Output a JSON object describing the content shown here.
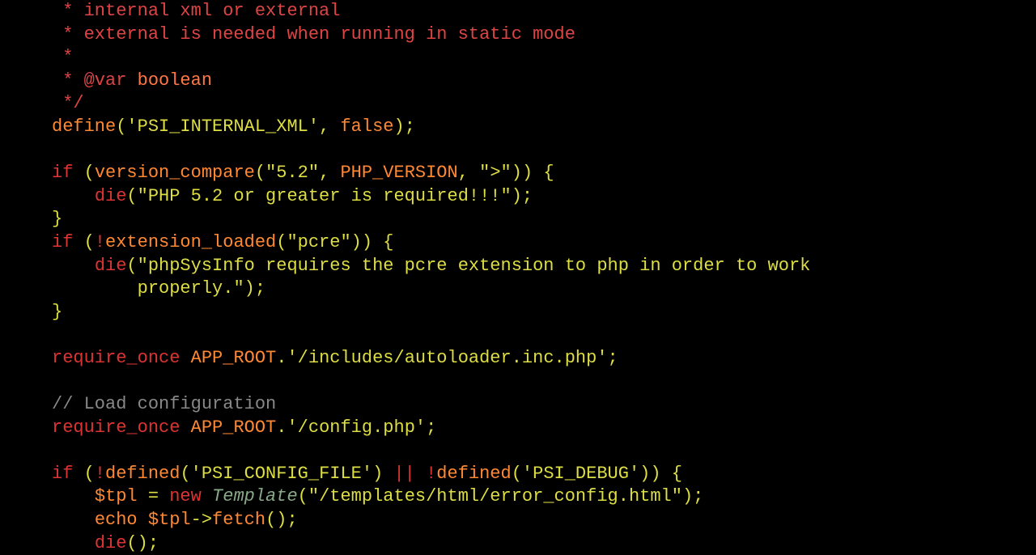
{
  "code": {
    "comment1": " * internal xml or external",
    "comment2": " * external is needed when running in static mode",
    "comment3": " *",
    "comment4_prefix": " * ",
    "doctag": "@var",
    "doctype": " boolean",
    "comment5": " */",
    "define": "define",
    "lparen": "(",
    "rparen": ")",
    "str_psi_internal": "'PSI_INTERNAL_XML'",
    "comma_sp": ", ",
    "false": "false",
    "semi": ";",
    "if": "if",
    "version_compare": "version_compare",
    "str_52": "\"5.2\"",
    "php_version": "PHP_VERSION",
    "str_gt": "\">\"",
    "die": "die",
    "str_php52req": "\"PHP 5.2 or greater is required!!!\"",
    "lbrace": "{",
    "rbrace": "}",
    "not": "!",
    "extension_loaded": "extension_loaded",
    "str_pcre": "\"pcre\"",
    "str_pcre_msg1": "\"phpSysInfo requires the pcre extension to php in order to work ",
    "str_pcre_msg2": "properly.\"",
    "require_once": "require_once",
    "app_root": "APP_ROOT",
    "dot": ".",
    "str_autoloader": "'/includes/autoloader.inc.php'",
    "linecomment": "// Load configuration",
    "str_config": "'/config.php'",
    "defined": "defined",
    "str_psi_config": "'PSI_CONFIG_FILE'",
    "or": "||",
    "str_psi_debug": "'PSI_DEBUG'",
    "tpl_var": "$tpl",
    "eq": " = ",
    "new": "new",
    "template": "Template",
    "str_template": "\"/templates/html/error_config.html\"",
    "echo": "echo",
    "arrow": "->",
    "fetch": "fetch",
    "die_empty": "()"
  }
}
